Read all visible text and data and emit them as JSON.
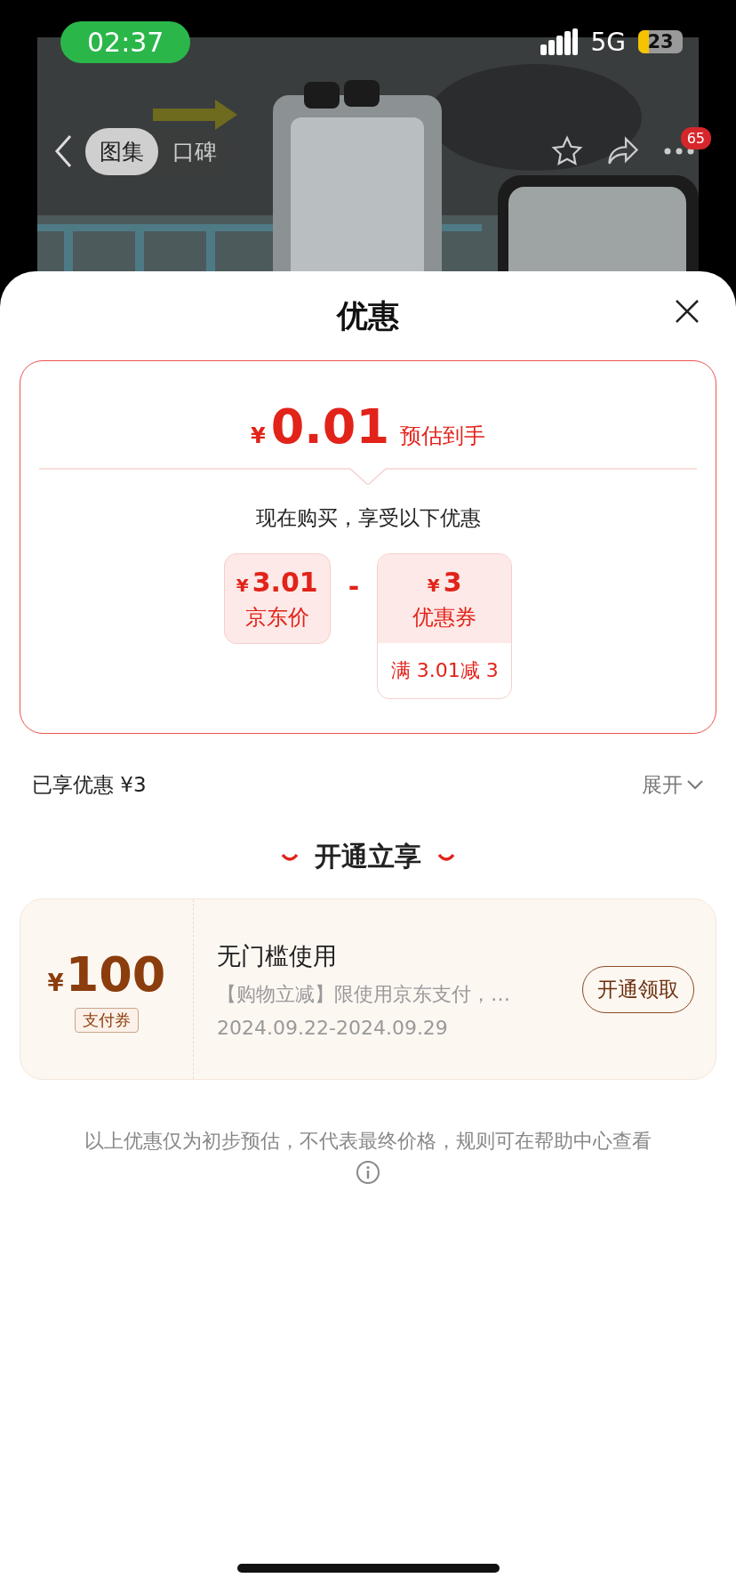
{
  "status_bar": {
    "time": "02:37",
    "network": "5G",
    "battery": "23"
  },
  "nav": {
    "tabs": [
      {
        "label": "图集",
        "selected": true
      },
      {
        "label": "口碑",
        "selected": false
      }
    ],
    "more_badge": "65"
  },
  "sheet": {
    "title": "优惠",
    "estimate": {
      "currency": "¥",
      "amount": "0.01",
      "label": "预估到手"
    },
    "subtitle": "现在购买，享受以下优惠",
    "breakdown": [
      {
        "currency": "¥",
        "amount": "3.01",
        "label": "京东价"
      },
      {
        "currency": "¥",
        "amount": "3",
        "label": "优惠券",
        "note": "满 3.01减 3"
      }
    ],
    "operator": "-",
    "savings": {
      "label": "已享优惠 ¥3",
      "toggle": "展开",
      "expanded": false
    },
    "section_title": "开通立享",
    "coupon": {
      "currency": "¥",
      "amount": "100",
      "tag": "支付券",
      "title": "无门槛使用",
      "description": "【购物立减】限使用京东支付，…",
      "validity": "2024.09.22-2024.09.29",
      "button": "开通领取"
    },
    "disclaimer": "以上优惠仅为初步预估，不代表最终价格，规则可在帮助中心查看"
  }
}
